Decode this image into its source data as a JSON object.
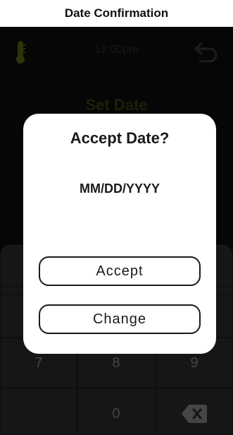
{
  "caption": "Date Confirmation",
  "status": {
    "time": "12:00pm",
    "thermometer_icon": "thermometer-icon",
    "back_icon": "back-arrow-icon"
  },
  "screen_title": "Set Date",
  "keypad": {
    "row3": [
      "7",
      "8",
      "9"
    ],
    "row4_middle": "0",
    "backspace_icon": "backspace-icon"
  },
  "dialog": {
    "title": "Accept Date?",
    "value": "MM/DD/YYYY",
    "accept_label": "Accept",
    "change_label": "Change"
  },
  "colors": {
    "accent": "#c8e21a",
    "background": "#0d0d0d",
    "dialog": "#ffffff"
  }
}
